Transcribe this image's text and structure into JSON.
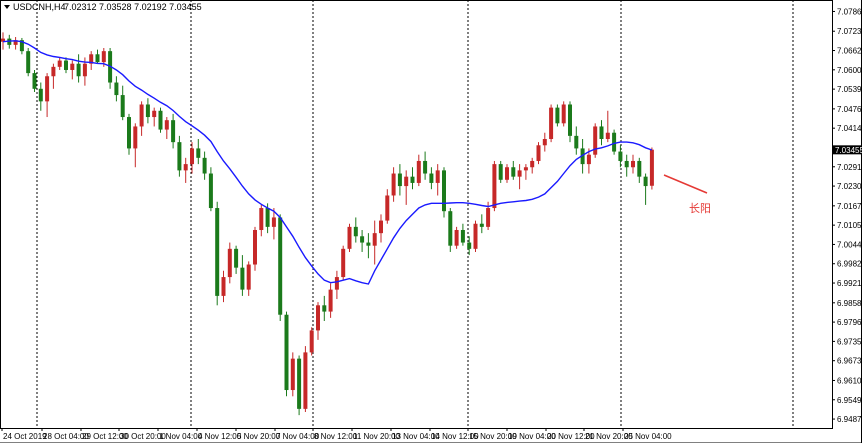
{
  "header": {
    "symbol": "USDCNH,H4",
    "ohlc": "7.02312 7.03528 7.02192 7.03455"
  },
  "colors": {
    "bull": "#c62828",
    "bear": "#1b7a1b",
    "ma": "#1a1aff",
    "annotation": "#e53935",
    "grid": "#000000",
    "price_tag_bg": "#000000"
  },
  "chart_data": {
    "type": "candlestick",
    "symbol": "USDCNH",
    "timeframe": "H4",
    "current_price": "7.03455",
    "ylim": [
      6.9459,
      7.0823
    ],
    "y_ticks": [
      "7.07865",
      "7.07235",
      "7.06620",
      "7.06005",
      "7.05390",
      "7.04760",
      "7.04145",
      "7.03455",
      "7.02915",
      "7.02300",
      "7.01670",
      "7.01055",
      "7.00440",
      "6.99825",
      "6.99210",
      "6.98580",
      "6.97965",
      "6.97350",
      "6.96735",
      "6.96105",
      "6.95490",
      "6.94875"
    ],
    "x_ticks": [
      "24 Oct 2019",
      "28 Oct 04:00",
      "29 Oct 12:00",
      "30 Oct 20:00",
      "1 Nov 04:00",
      "4 Nov 12:00",
      "5 Nov 20:00",
      "7 Nov 04:00",
      "8 Nov 12:00",
      "11 Nov 20:00",
      "13 Nov 04:00",
      "14 Nov 12:00",
      "15 Nov 20:00",
      "19 Nov 04:00",
      "20 Nov 12:00",
      "21 Nov 20:00",
      "25 Nov 04:00"
    ],
    "candles": [
      [
        7.069,
        7.072,
        7.0665,
        7.07
      ],
      [
        7.07,
        7.0712,
        7.0668,
        7.068
      ],
      [
        7.068,
        7.0705,
        7.0665,
        7.0695
      ],
      [
        7.0695,
        7.0702,
        7.065,
        7.066
      ],
      [
        7.066,
        7.067,
        7.058,
        7.059
      ],
      [
        7.059,
        7.06,
        7.053,
        7.054
      ],
      [
        7.054,
        7.056,
        7.047,
        7.05
      ],
      [
        7.05,
        7.059,
        7.045,
        7.058
      ],
      [
        7.058,
        7.062,
        7.054,
        7.061
      ],
      [
        7.061,
        7.064,
        7.06,
        7.063
      ],
      [
        7.063,
        7.064,
        7.059,
        7.06
      ],
      [
        7.06,
        7.063,
        7.057,
        7.062
      ],
      [
        7.062,
        7.065,
        7.056,
        7.058
      ],
      [
        7.058,
        7.064,
        7.055,
        7.062
      ],
      [
        7.062,
        7.066,
        7.06,
        7.065
      ],
      [
        7.065,
        7.0665,
        7.062,
        7.0625
      ],
      [
        7.0625,
        7.067,
        7.061,
        7.066
      ],
      [
        7.066,
        7.067,
        7.054,
        7.056
      ],
      [
        7.056,
        7.058,
        7.05,
        7.052
      ],
      [
        7.052,
        7.055,
        7.044,
        7.045
      ],
      [
        7.045,
        7.046,
        7.033,
        7.035
      ],
      [
        7.035,
        7.043,
        7.029,
        7.042
      ],
      [
        7.042,
        7.05,
        7.039,
        7.049
      ],
      [
        7.049,
        7.051,
        7.043,
        7.045
      ],
      [
        7.045,
        7.048,
        7.042,
        7.047
      ],
      [
        7.047,
        7.048,
        7.04,
        7.041
      ],
      [
        7.041,
        7.045,
        7.038,
        7.044
      ],
      [
        7.044,
        7.046,
        7.035,
        7.037
      ],
      [
        7.037,
        7.039,
        7.026,
        7.028
      ],
      [
        7.028,
        7.032,
        7.024,
        7.03
      ],
      [
        7.03,
        7.037,
        7.027,
        7.035
      ],
      [
        7.035,
        7.038,
        7.03,
        7.032
      ],
      [
        7.032,
        7.034,
        7.025,
        7.027
      ],
      [
        7.027,
        7.029,
        7.015,
        7.016
      ],
      [
        7.016,
        7.018,
        6.985,
        6.988
      ],
      [
        6.988,
        6.996,
        6.986,
        6.994
      ],
      [
        6.994,
        7.005,
        6.992,
        7.003
      ],
      [
        7.003,
        7.004,
        6.995,
        6.997
      ],
      [
        6.997,
        7.001,
        6.988,
        6.99
      ],
      [
        6.99,
        6.999,
        6.988,
        6.998
      ],
      [
        6.998,
        7.01,
        6.996,
        7.009
      ],
      [
        7.009,
        7.017,
        7.007,
        7.016
      ],
      [
        7.016,
        7.0175,
        7.008,
        7.01
      ],
      [
        7.01,
        7.016,
        7.006,
        7.013
      ],
      [
        7.013,
        7.014,
        6.98,
        6.982
      ],
      [
        6.982,
        6.983,
        6.956,
        6.958
      ],
      [
        6.958,
        6.97,
        6.956,
        6.968
      ],
      [
        6.968,
        6.969,
        6.95,
        6.952
      ],
      [
        6.952,
        6.972,
        6.951,
        6.97
      ],
      [
        6.97,
        6.978,
        6.969,
        6.977
      ],
      [
        6.977,
        6.986,
        6.974,
        6.985
      ],
      [
        6.985,
        6.988,
        6.98,
        6.983
      ],
      [
        6.983,
        6.992,
        6.981,
        6.99
      ],
      [
        6.99,
        6.996,
        6.987,
        6.994
      ],
      [
        6.994,
        7.004,
        6.993,
        7.003
      ],
      [
        7.003,
        7.011,
        7.002,
        7.01
      ],
      [
        7.01,
        7.013,
        7.005,
        7.007
      ],
      [
        7.007,
        7.009,
        7.002,
        7.005
      ],
      [
        7.005,
        7.008,
        7.0,
        7.004
      ],
      [
        7.004,
        7.012,
        6.998,
        7.008
      ],
      [
        7.008,
        7.014,
        7.005,
        7.012
      ],
      [
        7.012,
        7.022,
        7.011,
        7.02
      ],
      [
        7.02,
        7.029,
        7.018,
        7.027
      ],
      [
        7.027,
        7.03,
        7.02,
        7.023
      ],
      [
        7.023,
        7.028,
        7.017,
        7.026
      ],
      [
        7.026,
        7.029,
        7.022,
        7.024
      ],
      [
        7.024,
        7.033,
        7.023,
        7.031
      ],
      [
        7.031,
        7.034,
        7.025,
        7.027
      ],
      [
        7.027,
        7.029,
        7.022,
        7.024
      ],
      [
        7.024,
        7.03,
        7.02,
        7.028
      ],
      [
        7.028,
        7.029,
        7.013,
        7.015
      ],
      [
        7.015,
        7.016,
        7.002,
        7.004
      ],
      [
        7.004,
        7.01,
        7.003,
        7.009
      ],
      [
        7.009,
        7.011,
        7.004,
        7.005
      ],
      [
        7.005,
        7.007,
        7.001,
        7.003
      ],
      [
        7.003,
        7.012,
        7.002,
        7.011
      ],
      [
        7.011,
        7.014,
        7.008,
        7.01
      ],
      [
        7.01,
        7.018,
        7.009,
        7.016
      ],
      [
        7.016,
        7.031,
        7.015,
        7.03
      ],
      [
        7.03,
        7.031,
        7.024,
        7.025
      ],
      [
        7.025,
        7.03,
        7.024,
        7.029
      ],
      [
        7.029,
        7.031,
        7.025,
        7.026
      ],
      [
        7.026,
        7.03,
        7.022,
        7.028
      ],
      [
        7.028,
        7.03,
        7.025,
        7.029
      ],
      [
        7.029,
        7.032,
        7.027,
        7.031
      ],
      [
        7.031,
        7.037,
        7.03,
        7.036
      ],
      [
        7.036,
        7.04,
        7.034,
        7.038
      ],
      [
        7.038,
        7.049,
        7.037,
        7.048
      ],
      [
        7.048,
        7.049,
        7.042,
        7.043
      ],
      [
        7.043,
        7.05,
        7.042,
        7.049
      ],
      [
        7.049,
        7.05,
        7.037,
        7.039
      ],
      [
        7.039,
        7.042,
        7.033,
        7.035
      ],
      [
        7.035,
        7.038,
        7.027,
        7.03
      ],
      [
        7.03,
        7.035,
        7.027,
        7.033
      ],
      [
        7.033,
        7.043,
        7.032,
        7.042
      ],
      [
        7.042,
        7.044,
        7.036,
        7.038
      ],
      [
        7.038,
        7.047,
        7.037,
        7.04
      ],
      [
        7.04,
        7.041,
        7.033,
        7.034
      ],
      [
        7.034,
        7.036,
        7.029,
        7.031
      ],
      [
        7.031,
        7.033,
        7.026,
        7.029
      ],
      [
        7.029,
        7.033,
        7.027,
        7.031
      ],
      [
        7.031,
        7.032,
        7.024,
        7.026
      ],
      [
        7.026,
        7.027,
        7.017,
        7.023
      ],
      [
        7.0231,
        7.0353,
        7.0219,
        7.0346
      ]
    ],
    "ma_series": [
      7.069,
      7.0692,
      7.0693,
      7.069,
      7.0682,
      7.067,
      7.0656,
      7.0648,
      7.0643,
      7.064,
      7.0636,
      7.0633,
      7.0628,
      7.0625,
      7.0624,
      7.0621,
      7.062,
      7.0612,
      7.06,
      7.0585,
      7.0565,
      7.0548,
      7.0536,
      7.0522,
      7.051,
      7.0497,
      7.0486,
      7.0471,
      7.0452,
      7.0435,
      7.0422,
      7.0408,
      7.0392,
      7.0372,
      7.034,
      7.031,
      7.0285,
      7.0258,
      7.023,
      7.0205,
      7.0186,
      7.0172,
      7.016,
      7.015,
      7.013,
      7.01,
      7.007,
      7.0035,
      7.0002,
      6.9975,
      6.995,
      6.993,
      6.9922,
      6.9925,
      6.993,
      6.9935,
      6.9928,
      6.9922,
      6.9918,
      6.996,
      6.9995,
      7.003,
      7.0065,
      7.0095,
      7.012,
      7.014,
      7.016,
      7.017,
      7.0175,
      7.0175,
      7.0175,
      7.0176,
      7.0177,
      7.0177,
      7.0175,
      7.0172,
      7.0168,
      7.0165,
      7.017,
      7.0175,
      7.0178,
      7.018,
      7.0182,
      7.0184,
      7.0188,
      7.0195,
      7.0205,
      7.0225,
      7.0245,
      7.027,
      7.0295,
      7.0315,
      7.0328,
      7.034,
      7.0348,
      7.0352,
      7.0358,
      7.0366,
      7.037,
      7.037,
      7.0368,
      7.0362,
      7.0352,
      7.0345
    ],
    "grid": "vertical dashed",
    "annotation": "长阳"
  }
}
